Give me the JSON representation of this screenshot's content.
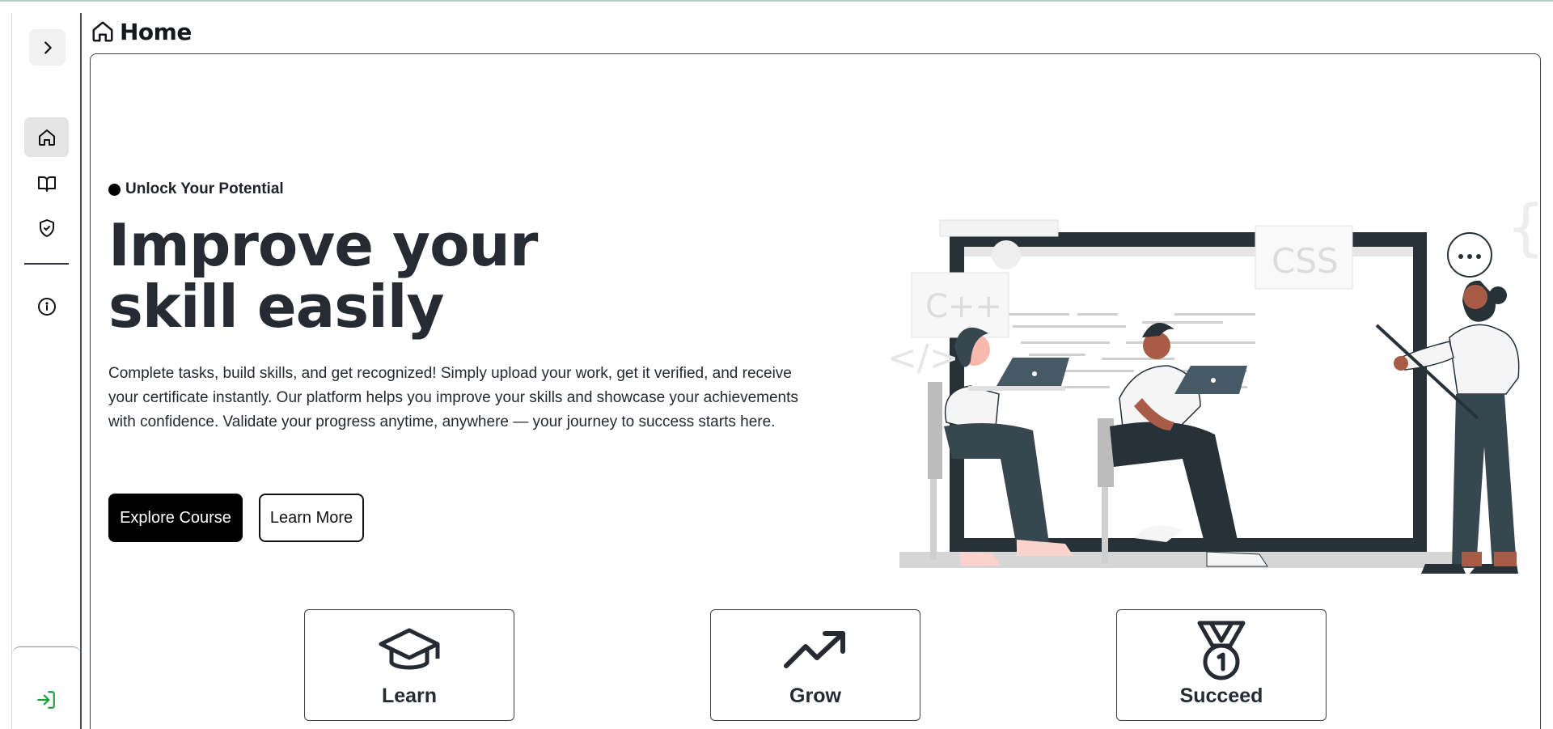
{
  "header": {
    "title": "Home",
    "icon": "home-icon"
  },
  "sidebar": {
    "toggle_icon": "chevron-right-icon",
    "items": [
      {
        "name": "home",
        "icon": "home-icon",
        "active": true
      },
      {
        "name": "courses",
        "icon": "book-open-icon",
        "active": false
      },
      {
        "name": "verification",
        "icon": "shield-check-icon",
        "active": false
      },
      {
        "name": "about",
        "icon": "info-icon",
        "active": false
      }
    ],
    "login_icon": "log-in-icon",
    "login_color": "#1f9d3a"
  },
  "hero": {
    "tagline": "Unlock Your Potential",
    "title_strong": "Improve",
    "title_rest": " your",
    "title_line2": "skill easily",
    "description": "Complete tasks, build skills, and get recognized! Simply upload your work, get it verified, and receive your certificate instantly. Our platform helps you improve your skills and showcase your achievements with confidence. Validate your progress anytime, anywhere — your journey to success starts here.",
    "primary_button": "Explore Course",
    "secondary_button": "Learn More",
    "illustration": {
      "labels": [
        "C++",
        "CSS",
        "</>",
        "{ }"
      ]
    }
  },
  "features": [
    {
      "label": "Learn",
      "icon": "graduation-cap-icon"
    },
    {
      "label": "Grow",
      "icon": "trending-up-icon"
    },
    {
      "label": "Succeed",
      "icon": "medal-icon"
    }
  ],
  "colors": {
    "primary": "#000000",
    "text": "#222831",
    "accent_green": "#1f9d3a"
  }
}
